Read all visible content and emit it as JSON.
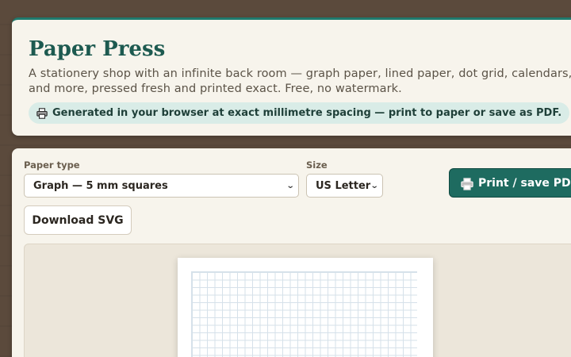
{
  "header": {
    "title": "Paper Press",
    "description": "A stationery shop with an infinite back room — graph paper, lined paper, dot grid, calendars, and more, pressed fresh and printed exact. Free, no watermark.",
    "info": "Generated in your browser at exact millimetre spacing — print to paper or save as PDF."
  },
  "controls": {
    "paper_type_label": "Paper type",
    "paper_type_value": "Graph — 5 mm squares",
    "size_label": "Size",
    "size_value": "US Letter",
    "print_label": "Print / save PDF",
    "download_label": "Download SVG"
  },
  "icons": {
    "info": "printer-icon",
    "print": "printer-icon",
    "select_arrow": "chevron-down-icon"
  },
  "colors": {
    "accent": "#1e6b60",
    "title": "#1d5a50",
    "background": "#5b4a3c",
    "card": "#f7f4ec"
  }
}
